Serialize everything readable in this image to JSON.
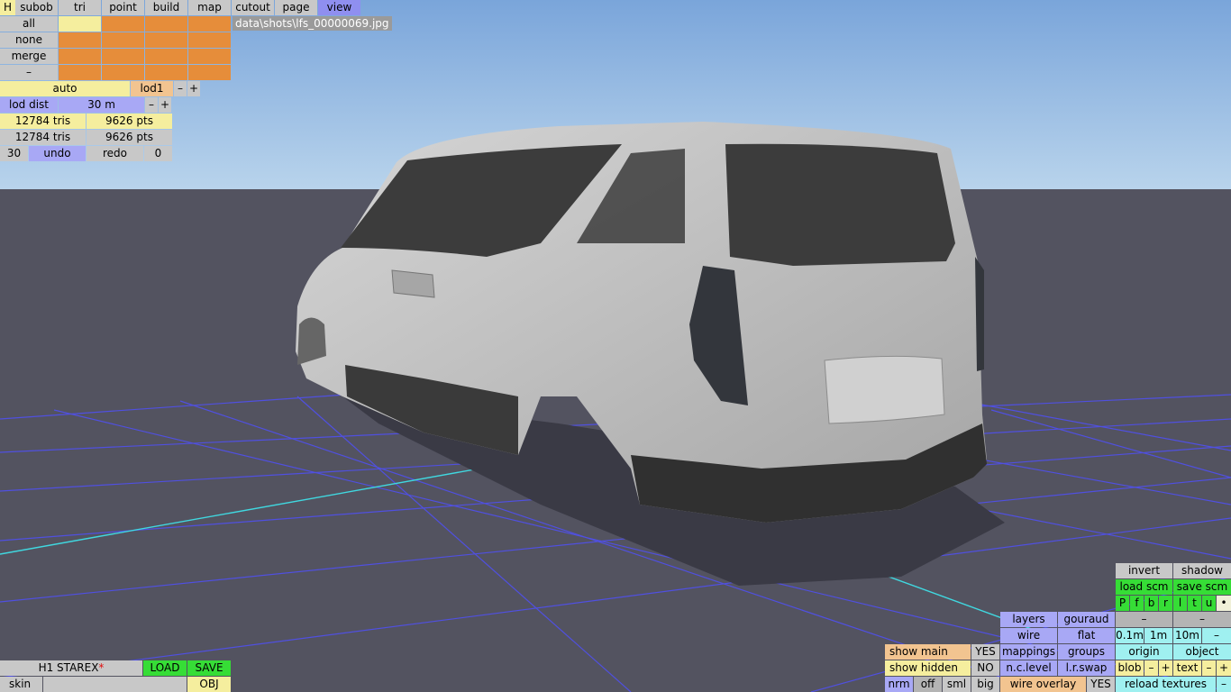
{
  "tabs": {
    "h": "H",
    "subob": "subob",
    "tri": "tri",
    "point": "point",
    "build": "build",
    "map": "map",
    "cutout": "cutout",
    "page": "page",
    "view": "view"
  },
  "filepath": "data\\shots\\lfs_00000069.jpg",
  "select": {
    "all": "all",
    "none": "none",
    "merge": "merge",
    "minus": "–"
  },
  "lod": {
    "auto": "auto",
    "lod1": "lod1",
    "minus": "–",
    "plus": "+",
    "dist_label": "lod dist",
    "dist_value": "30 m"
  },
  "stats": {
    "row1": {
      "tris": "12784 tris",
      "pts": "9626 pts"
    },
    "row2": {
      "tris": "12784 tris",
      "pts": "9626 pts"
    }
  },
  "history": {
    "count": "30",
    "undo": "undo",
    "redo": "redo",
    "redo_count": "0"
  },
  "model": {
    "name": "H1 STAREX",
    "modified_mark": "*",
    "load": "LOAD",
    "save": "SAVE",
    "skin": "skin",
    "obj": "OBJ"
  },
  "show": {
    "main": "show main",
    "main_val": "YES",
    "hidden": "show hidden",
    "hidden_val": "NO",
    "nrm": "nrm",
    "off": "off",
    "sml": "sml",
    "big": "big"
  },
  "render": {
    "layers": "layers",
    "gouraud": "gouraud",
    "wire": "wire",
    "flat": "flat",
    "mappings": "mappings",
    "groups": "groups",
    "nclevel": "n.c.level",
    "lrswap": "l.r.swap",
    "wire_overlay": "wire overlay",
    "wire_overlay_val": "YES"
  },
  "right": {
    "invert": "invert",
    "shadow": "shadow",
    "load_scm": "load scm",
    "save_scm": "save scm",
    "views": [
      "P",
      "f",
      "b",
      "r",
      "l",
      "t",
      "u"
    ],
    "dot": "•",
    "minus": "–",
    "d01": "0.1m",
    "d1": "1m",
    "d10": "10m",
    "origin": "origin",
    "object": "object",
    "blob": "blob",
    "text": "text",
    "plus": "+",
    "reload": "reload textures"
  },
  "colors": {
    "sky_top": "#7aa5da",
    "sky_bottom": "#b9d4ec",
    "ground": "#535360",
    "grid": "#5050e0",
    "axis": "#40d8e0"
  }
}
